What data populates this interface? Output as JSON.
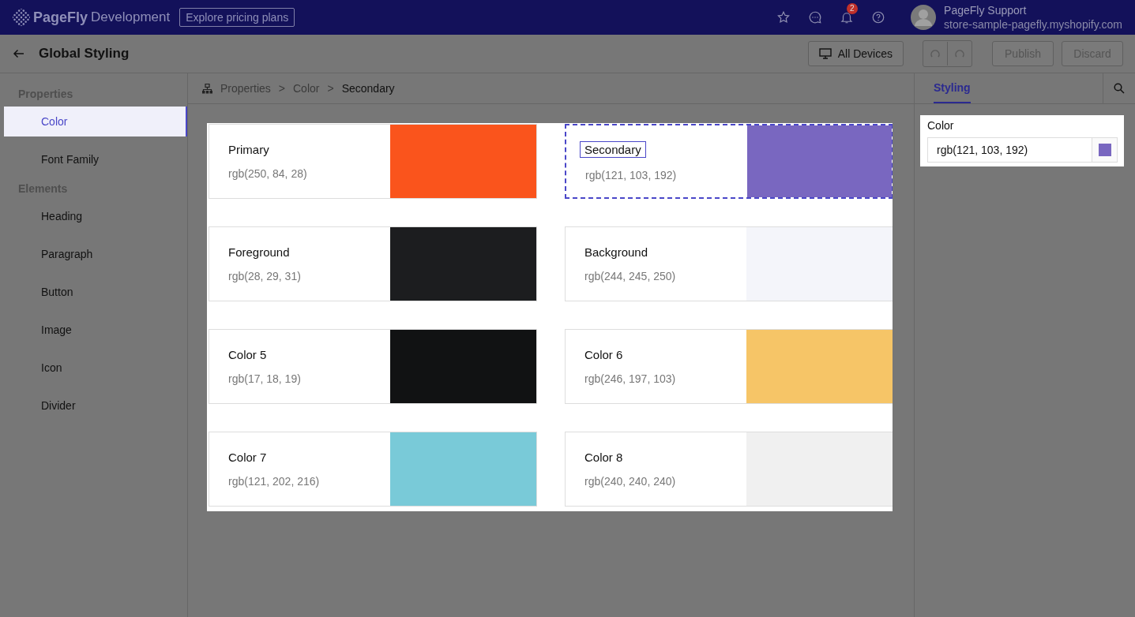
{
  "top_bar": {
    "brand": "PageFly",
    "brand_suffix": "Development",
    "pricing_button": "Explore pricing plans",
    "notification_count": "2",
    "user": {
      "name": "PageFly Support",
      "store": "store-sample-pagefly.myshopify.com"
    }
  },
  "toolbar": {
    "title": "Global Styling",
    "device_button": "All Devices",
    "actions": [
      {
        "label": "Publish",
        "disabled": true
      },
      {
        "label": "Discard",
        "disabled": true
      }
    ]
  },
  "sidebar": {
    "sections": [
      {
        "title": "Properties",
        "items": [
          {
            "label": "Color",
            "selected": true
          },
          {
            "label": "Font Family",
            "selected": false
          }
        ]
      },
      {
        "title": "Elements",
        "items": [
          {
            "label": "Heading",
            "selected": false
          },
          {
            "label": "Paragraph",
            "selected": false
          },
          {
            "label": "Button",
            "selected": false
          },
          {
            "label": "Image",
            "selected": false
          },
          {
            "label": "Icon",
            "selected": false
          },
          {
            "label": "Divider",
            "selected": false
          }
        ]
      }
    ]
  },
  "breadcrumb": {
    "items": [
      "Properties",
      "Color",
      "Secondary"
    ],
    "separator": ">"
  },
  "swatches": [
    {
      "name": "Primary",
      "value": "rgb(250, 84, 28)",
      "color": "#fa541c",
      "selected": false
    },
    {
      "name": "Secondary",
      "value": "rgb(121, 103, 192)",
      "color": "#7967c0",
      "selected": true
    },
    {
      "name": "Foreground",
      "value": "rgb(28, 29, 31)",
      "color": "#1c1d1f",
      "selected": false
    },
    {
      "name": "Background",
      "value": "rgb(244, 245, 250)",
      "color": "#f4f5fa",
      "selected": false
    },
    {
      "name": "Color 5",
      "value": "rgb(17, 18, 19)",
      "color": "#111213",
      "selected": false
    },
    {
      "name": "Color 6",
      "value": "rgb(246, 197, 103)",
      "color": "#f6c567",
      "selected": false
    },
    {
      "name": "Color 7",
      "value": "rgb(121, 202, 216)",
      "color": "#79cad8",
      "selected": false
    },
    {
      "name": "Color 8",
      "value": "rgb(240, 240, 240)",
      "color": "#f0f0f0",
      "selected": false
    }
  ],
  "panel": {
    "tabs": [
      {
        "label": "Styling",
        "selected": true
      }
    ],
    "field_label": "Color",
    "field_value": "rgb(121, 103, 192)",
    "color": "#7967c0"
  }
}
